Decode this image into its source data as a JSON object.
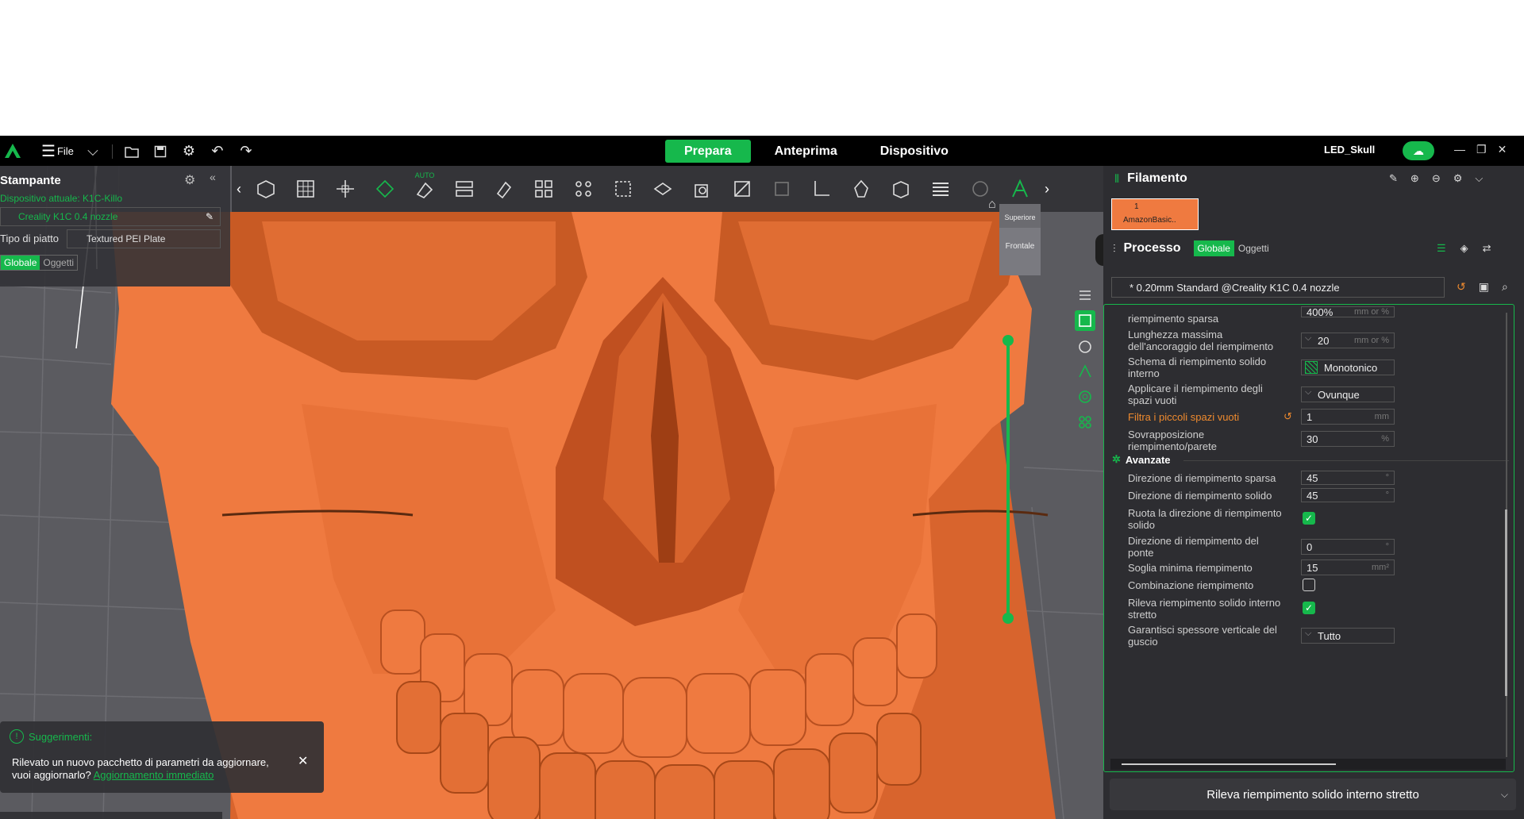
{
  "topbar": {
    "file_label": "File",
    "tabs": [
      "Prepara",
      "Anteprima",
      "Dispositivo"
    ],
    "project_name": "LED_Skull"
  },
  "printer_panel": {
    "title": "Stampante",
    "device": "Dispositivo attuale: K1C-Killo",
    "printer": "Creality K1C 0.4 nozzle",
    "plate_label": "Tipo di piatto",
    "plate_value": "Textured PEI Plate",
    "toggle": [
      "Globale",
      "Oggetti"
    ]
  },
  "toolbar": {
    "auto_label": "AUTO"
  },
  "viewcube": {
    "top": "Superiore",
    "front": "Frontale"
  },
  "suggestion": {
    "title": "Suggerimenti:",
    "text": "Rilevato un nuovo pacchetto di parametri da aggiornare, vuoi aggiornarlo?",
    "link": "Aggiornamento immediato"
  },
  "filament": {
    "title": "Filamento",
    "slot_number": "1",
    "slot_name": "AmazonBasic.."
  },
  "process": {
    "title": "Processo",
    "toggle": [
      "Globale",
      "Oggetti"
    ],
    "preset": "* 0.20mm Standard @Creality K1C 0.4 nozzle"
  },
  "settings": {
    "rows": [
      {
        "label": "riempimento sparsa",
        "value": "400%",
        "unit": "mm or %"
      },
      {
        "label": "Lunghezza massima dell'ancoraggio del riempimento",
        "value": "20",
        "unit": "mm or %"
      },
      {
        "label": "Schema di riempimento solido interno",
        "value": "Monotonico"
      },
      {
        "label": "Applicare il riempimento degli spazi vuoti",
        "value": "Ovunque"
      },
      {
        "label": "Filtra i piccoli spazi vuoti",
        "value": "1",
        "unit": "mm"
      },
      {
        "label": "Sovrapposizione riempimento/parete",
        "value": "30",
        "unit": "%"
      }
    ],
    "advanced_title": "Avanzate",
    "advanced_rows": [
      {
        "label": "Direzione di riempimento sparsa",
        "value": "45",
        "unit": "°"
      },
      {
        "label": "Direzione di riempimento solido",
        "value": "45",
        "unit": "°"
      },
      {
        "label": "Ruota la direzione di riempimento solido",
        "checked": true
      },
      {
        "label": "Direzione di riempimento del ponte",
        "value": "0",
        "unit": "°"
      },
      {
        "label": "Soglia minima riempimento",
        "value": "15",
        "unit": "mm²"
      },
      {
        "label": "Combinazione riempimento",
        "checked": false
      },
      {
        "label": "Rileva riempimento solido interno stretto",
        "checked": true
      },
      {
        "label": "Garantisci spessore verticale del guscio",
        "value": "Tutto"
      }
    ]
  },
  "bottom_button": "Rileva riempimento solido interno stretto",
  "colors": {
    "accent": "#16b84c",
    "model": "#ef7a40",
    "warning": "#ef8a2e"
  }
}
